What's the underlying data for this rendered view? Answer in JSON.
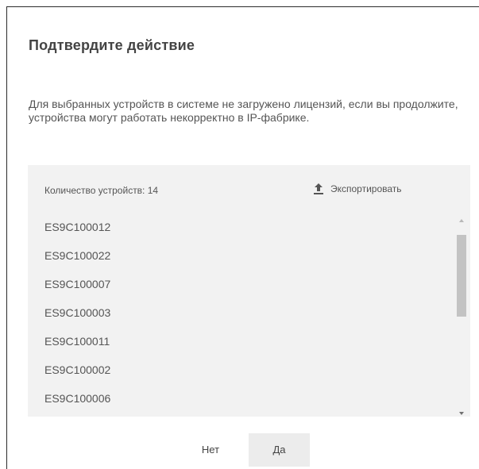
{
  "dialog": {
    "title": "Подтвердите действие",
    "message": "Для выбранных устройств в системе не загружено лицензий, если вы продолжите, устройства могут работать некорректно в IP-фабрике."
  },
  "panel": {
    "count_label": "Количество устройств: 14",
    "export_label": "Экспортировать",
    "export_icon": "upload-icon",
    "devices": [
      "ES9C100012",
      "ES9C100022",
      "ES9C100007",
      "ES9C100003",
      "ES9C100011",
      "ES9C100002",
      "ES9C100006"
    ]
  },
  "buttons": {
    "no_label": "Нет",
    "yes_label": "Да"
  }
}
